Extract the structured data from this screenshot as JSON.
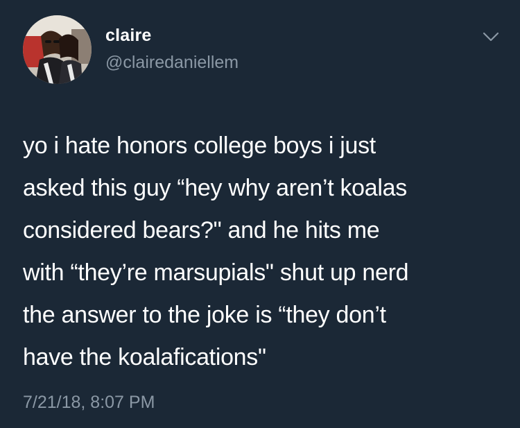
{
  "tweet": {
    "author": {
      "display_name": "claire",
      "handle": "@clairedaniellem",
      "avatar_icon": "profile-photo"
    },
    "menu_icon": "chevron-down-icon",
    "text_lines": [
      "yo i hate honors college boys i just",
      "asked this guy “hey why aren’t koalas",
      "considered bears?\" and he hits me",
      "with “they’re marsupials\" shut up nerd",
      "the answer to the joke is “they don’t",
      "have the koalafications\""
    ],
    "timestamp": "7/21/18, 8:07 PM"
  },
  "colors": {
    "background": "#1b2836",
    "primary_text": "#ffffff",
    "secondary_text": "#8b98a5"
  }
}
